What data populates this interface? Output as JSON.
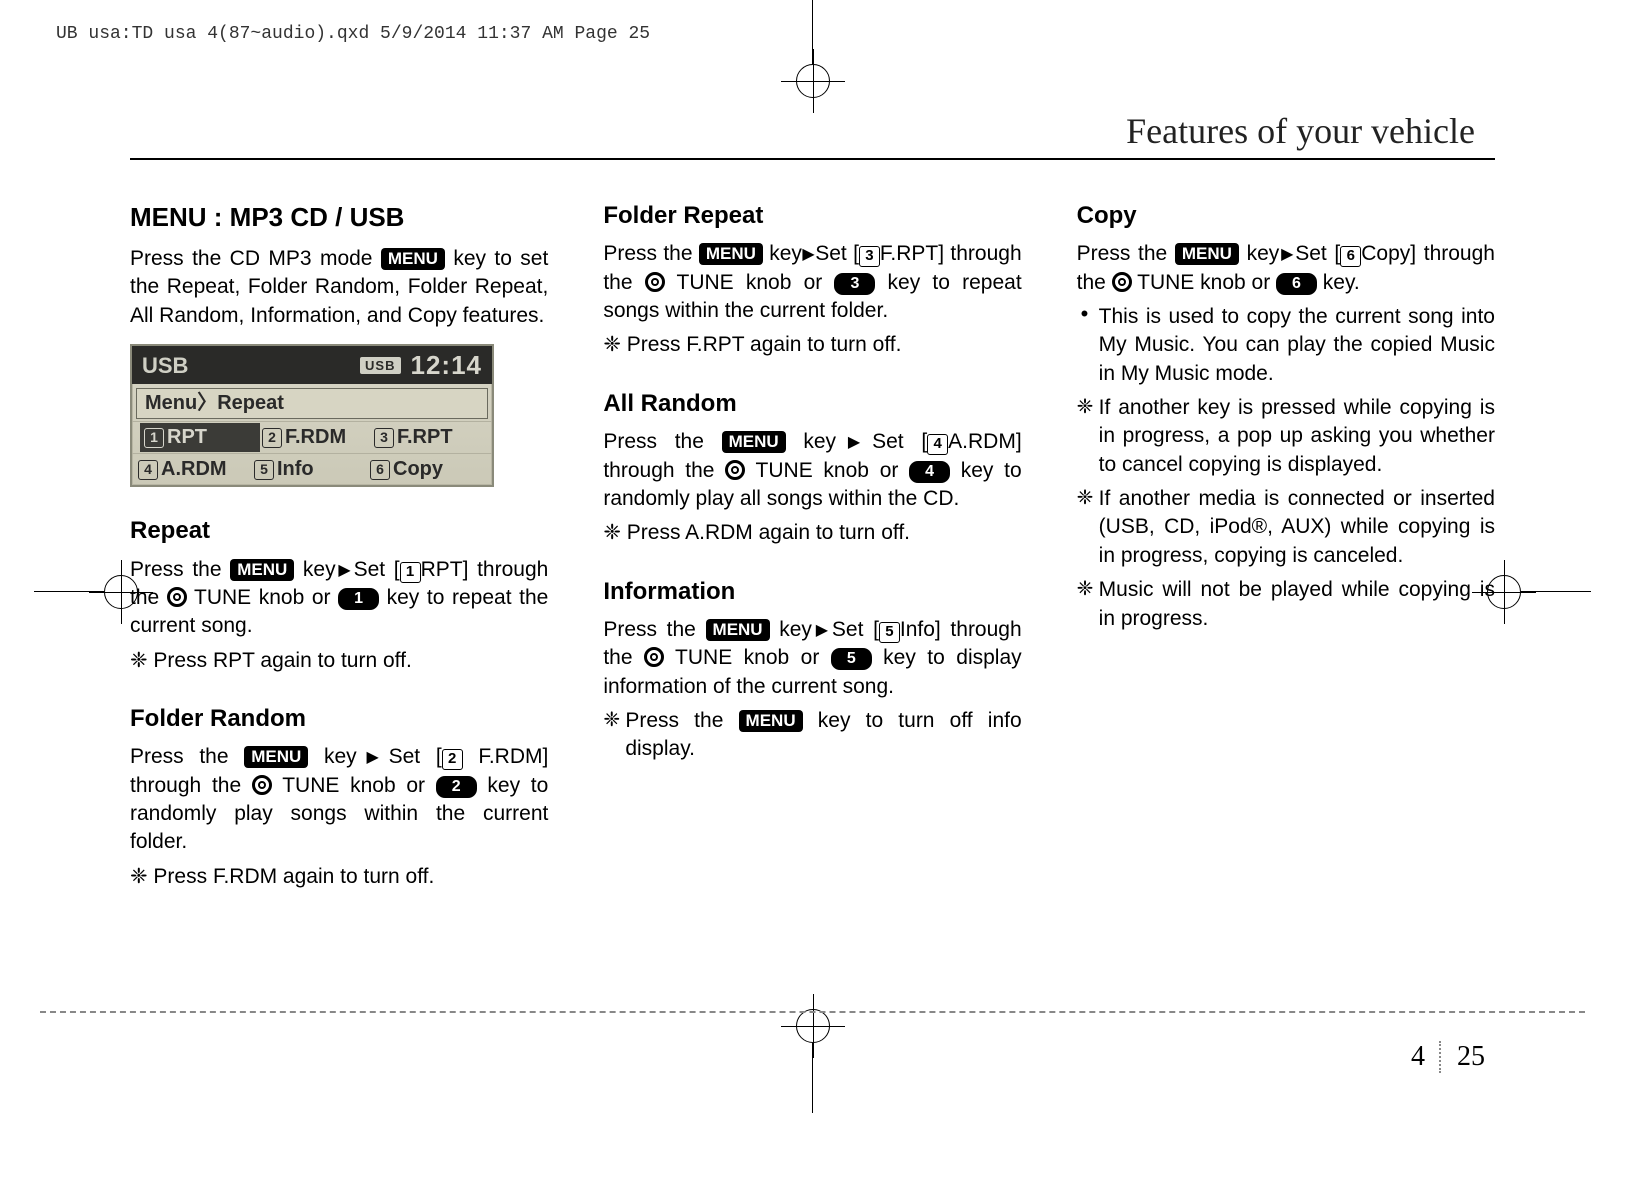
{
  "print_header": "UB usa:TD usa 4(87~audio).qxd  5/9/2014  11:37 AM  Page 25",
  "chapter_title": "Features of your vehicle",
  "page_number_left": "4",
  "page_number_right": "25",
  "keys": {
    "menu": "MENU",
    "n1": "1",
    "n2": "2",
    "n3": "3",
    "n4": "4",
    "n5": "5",
    "n6": "6"
  },
  "col1": {
    "title": "MENU : MP3 CD / USB",
    "intro_1": "Press the CD MP3 mode ",
    "intro_2": " key to set the Repeat, Folder Random, Folder Repeat, All Random, Information, and Copy features.",
    "repeat": {
      "title": "Repeat",
      "p1a": "Press the ",
      "p1b": " key",
      "p1c": "Set [",
      "p1d": "RPT] through the ",
      "p1e": " TUNE knob or ",
      "p1f": " key to repeat the current song.",
      "note": "❈ Press RPT again to turn off."
    },
    "folder_random": {
      "title": "Folder Random",
      "p1a": "Press the ",
      "p1b": " key",
      "p1c": "Set [",
      "p1d": " F.RDM] through the ",
      "p1e": " TUNE knob or ",
      "p1f": " key to randomly play songs within the current folder.",
      "note": "❈ Press F.RDM again to turn off."
    }
  },
  "col2": {
    "folder_repeat": {
      "title": "Folder Repeat",
      "p1a": "Press the ",
      "p1b": " key",
      "p1c": "Set [",
      "p1d": "F.RPT] through the ",
      "p1e": " TUNE knob or ",
      "p1f": " key to repeat songs within the current folder.",
      "note": "❈ Press F.RPT again to turn off."
    },
    "all_random": {
      "title": "All Random",
      "p1a": "Press the ",
      "p1b": " key",
      "p1c": "Set [",
      "p1d": "A.RDM] through the ",
      "p1e": " TUNE knob or ",
      "p1f": " key to randomly play all songs within the CD.",
      "note": "❈ Press A.RDM again to turn off."
    },
    "information": {
      "title": "Information",
      "p1a": "Press the ",
      "p1b": " key",
      "p1c": "Set [",
      "p1d": "Info] through the ",
      "p1e": " TUNE knob or ",
      "p1f": " key to display information of the current song.",
      "note_a": "Press the ",
      "note_b": " key to turn off info display."
    }
  },
  "col3": {
    "copy": {
      "title": "Copy",
      "p1a": "Press the ",
      "p1b": " key",
      "p1c": "Set [",
      "p1d": "Copy] through the ",
      "p1e": " TUNE knob or ",
      "p1f": " key.",
      "b1": "This is used to copy the current song into My Music. You can play the copied Music in My Music mode.",
      "b2": "If another key is pressed while copying is in progress, a pop up asking you whether to cancel copying is displayed.",
      "b3": "If another media is connected or inserted (USB, CD, iPod®, AUX) while copying is in progress, copying is canceled.",
      "b4": "Music will not be played while copying is in progress."
    }
  },
  "screen": {
    "title": "USB",
    "badge": "USB",
    "clock": "12:14",
    "breadcrumb": "Menu〉Repeat",
    "items": [
      {
        "n": "1",
        "label": "RPT"
      },
      {
        "n": "2",
        "label": "F.RDM"
      },
      {
        "n": "3",
        "label": "F.RPT"
      },
      {
        "n": "4",
        "label": "A.RDM"
      },
      {
        "n": "5",
        "label": "Info"
      },
      {
        "n": "6",
        "label": "Copy"
      }
    ]
  },
  "circled": {
    "c1": "1",
    "c2": "2",
    "c3": "3",
    "c4": "4",
    "c5": "5",
    "c6": "6"
  }
}
